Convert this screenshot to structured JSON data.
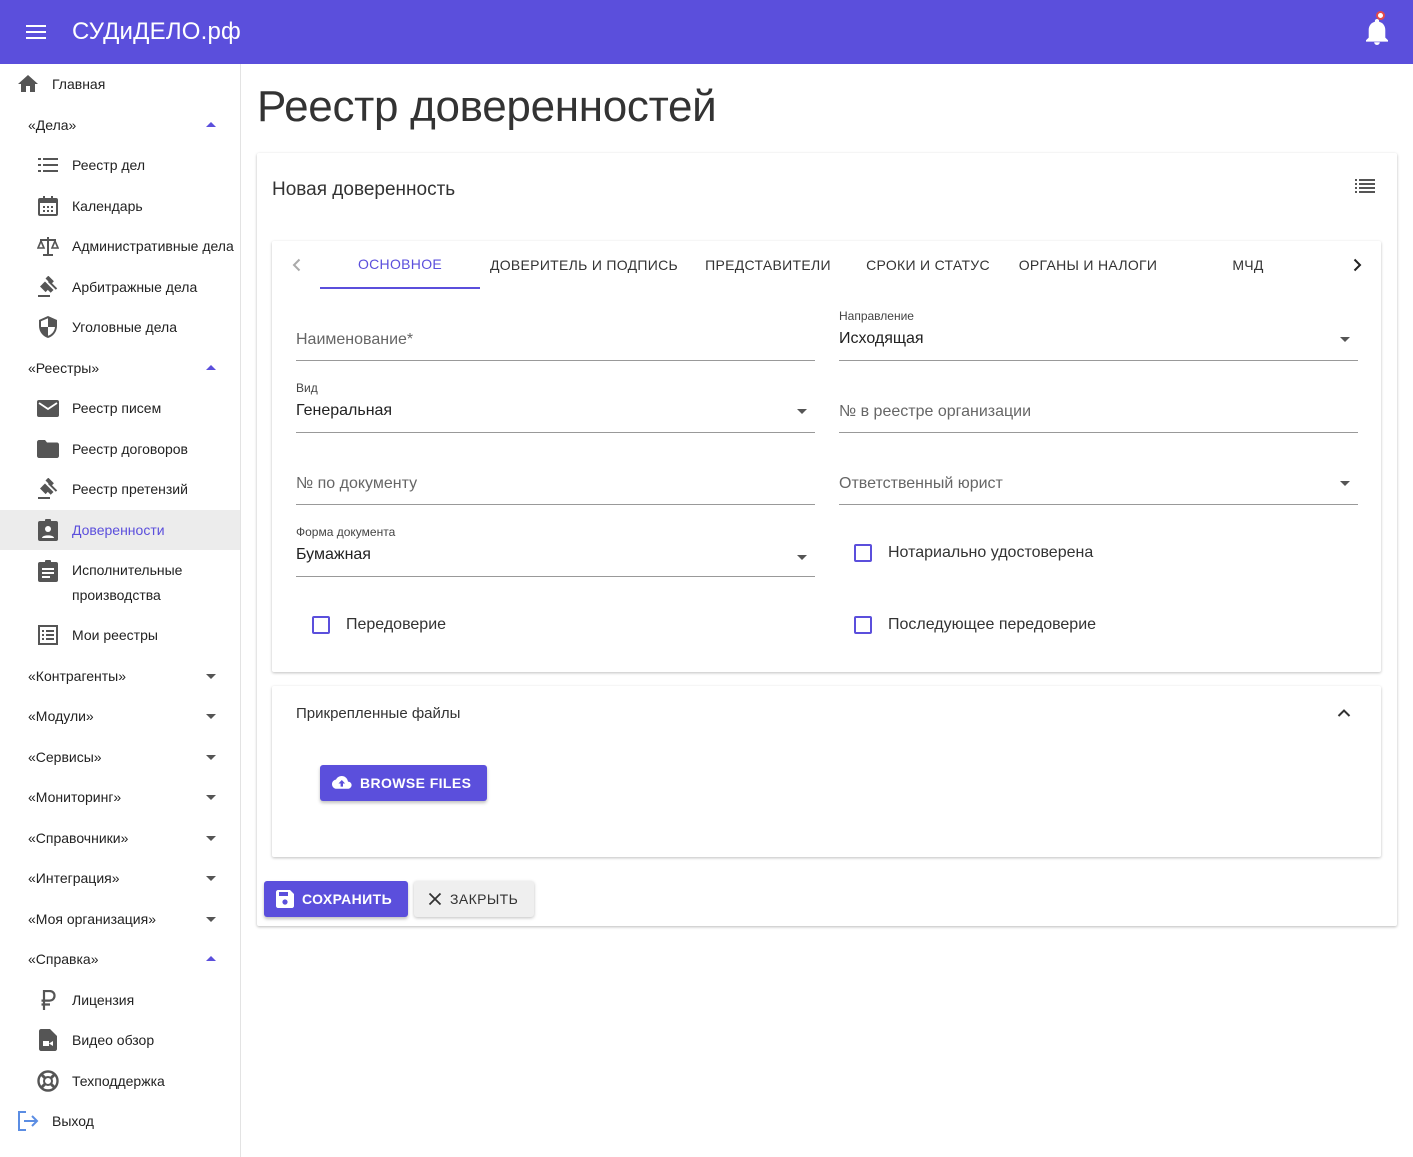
{
  "appbar": {
    "title": "СУДиДЕЛО.рф"
  },
  "sidebar": {
    "home": "Главная",
    "cases_section": "«Дела»",
    "cases_items": [
      "Реестр дел",
      "Календарь",
      "Административные дела",
      "Арбитражные дела",
      "Уголовные дела"
    ],
    "registers_section": "«Реестры»",
    "registers_items": [
      "Реестр писем",
      "Реестр договоров",
      "Реестр претензий",
      "Доверенности",
      "Исполнительные",
      "производства",
      "Мои реестры"
    ],
    "collapsed_sections": [
      "«Контрагенты»",
      "«Модули»",
      "«Сервисы»",
      "«Мониторинг»",
      "«Справочники»",
      "«Интеграция»",
      "«Моя организация»"
    ],
    "help_section": "«Справка»",
    "help_items": [
      "Лицензия",
      "Видео обзор",
      "Техподдержка"
    ],
    "logout": "Выход"
  },
  "page": {
    "title": "Реестр доверенностей"
  },
  "card": {
    "title": "Новая доверенность"
  },
  "tabs": [
    "Основное",
    "Доверитель и подпись",
    "Представители",
    "Сроки и статус",
    "Органы и налоги",
    "МЧД"
  ],
  "form": {
    "name_placeholder": "Наименование*",
    "direction_label": "Направление",
    "direction_value": "Исходящая",
    "kind_label": "Вид",
    "kind_value": "Генеральная",
    "org_number_placeholder": "№ в реестре организации",
    "doc_number_placeholder": "№ по документу",
    "lawyer_placeholder": "Ответственный юрист",
    "doc_form_label": "Форма документа",
    "doc_form_value": "Бумажная",
    "notarized_label": "Нотариально удостоверена",
    "redelegation_label": "Передоверие",
    "subsequent_label": "Последующее передоверие"
  },
  "files": {
    "title": "Прикрепленные файлы",
    "browse_label": "Browse files"
  },
  "actions": {
    "save_label": "Сохранить",
    "close_label": "Закрыть"
  },
  "colors": {
    "accent": "#5b4fdc"
  }
}
